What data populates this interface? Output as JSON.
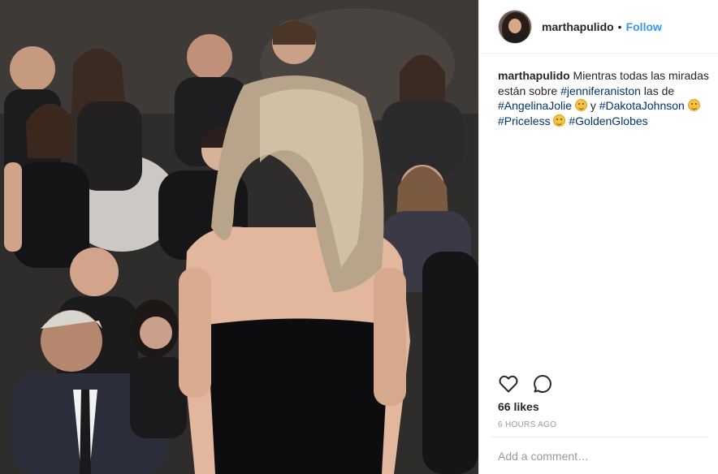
{
  "post": {
    "username": "marthapulido",
    "separator": "•",
    "follow_label": "Follow",
    "caption": {
      "username": "marthapulido",
      "text_1": " Mientras todas las miradas están sobre ",
      "tag_1": "#jenniferaniston",
      "text_2": " las de ",
      "tag_2": "#AngelinaJolie",
      "text_3": " y ",
      "tag_3": "#DakotaJohnson",
      "tag_4": "#Priceless",
      "tag_5": "#GoldenGlobes"
    },
    "likes": "66 likes",
    "timestamp": "6 HOURS AGO",
    "comment_placeholder": "Add a comment…"
  },
  "icons": {
    "like": "heart-icon",
    "comment": "speech-bubble-icon",
    "emoji": "smiley-emoji-icon"
  },
  "colors": {
    "link": "#3897f0",
    "hashtag": "#003569",
    "muted": "#999999",
    "text": "#262626",
    "border": "#efefef"
  }
}
